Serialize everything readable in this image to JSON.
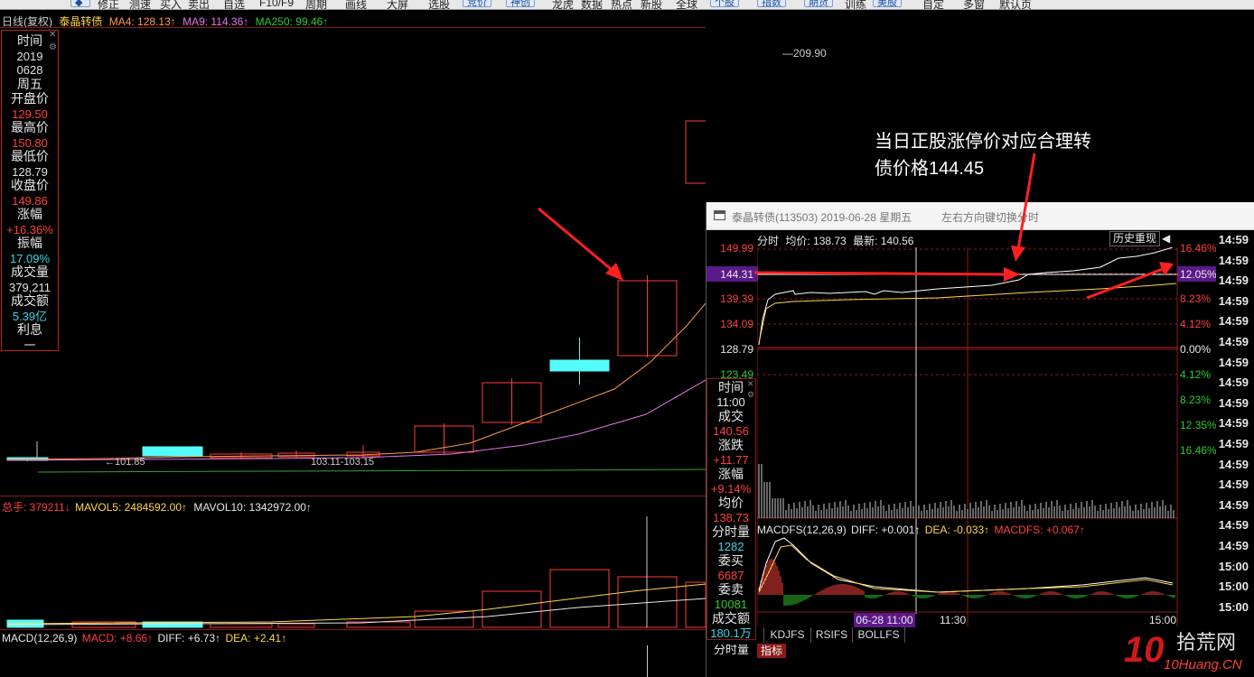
{
  "toolbar": {
    "items": [
      "修正",
      "测速",
      "买入",
      "卖出",
      "自选",
      "F10/F9",
      "周期",
      "画线",
      "大屏",
      "选股",
      "龙虎",
      "数据",
      "热点",
      "新股",
      "全球",
      "训练",
      "自定",
      "多窗",
      "默认页"
    ],
    "buttons": [
      "竞价",
      "神创",
      "个股",
      "指数",
      "期货",
      "美股"
    ]
  },
  "kline": {
    "period_label": "日线(复权)",
    "name": "泰晶转债",
    "ma4": "MA4: 128.13↑",
    "ma9": "MA9: 114.36↑",
    "ma250": "MA250: 99.46↑",
    "high_label": "209.90",
    "low_label": "←101.85",
    "range_label": "103.11-103.15",
    "colors": {
      "up": "#ff3c3c",
      "down": "#54fcfc",
      "ma4": "#ff9a4a",
      "ma9": "#e876e8",
      "ma250": "#2ea82e"
    }
  },
  "cursor_info": {
    "time_label": "时间",
    "year": "2019",
    "date": "0628",
    "weekday": "周五",
    "open_label": "开盘价",
    "open": "129.50",
    "high_label": "最高价",
    "high": "150.80",
    "low_label": "最低价",
    "low": "128.79",
    "close_label": "收盘价",
    "close": "149.86",
    "chg_label": "涨幅",
    "chg": "+16.36%",
    "amp_label": "振幅",
    "amp": "17.09%",
    "vol_label": "成交量",
    "vol": "379,211",
    "amt_label": "成交额",
    "amt": "5.39亿",
    "int_label": "利息",
    "int": "一"
  },
  "volume": {
    "total": "总手: 379211↓",
    "mavol5": "MAVOL5: 2484592.00↑",
    "mavol10": "MAVOL10: 1342972.00↑"
  },
  "macd": {
    "title": "MACD(12,26,9)",
    "macd": "MACD: +8.66↑",
    "diff": "DIFF: +6.73↑",
    "dea": "DEA: +2.41↑"
  },
  "annotation": {
    "line1": "当日正股涨停价对应合理转",
    "line2": "债价格144.45"
  },
  "popup": {
    "title": "泰晶转债(113503) 2019-06-28 星期五",
    "hint": "左右方向键切换分时",
    "header_label": "分时",
    "avg": "均价: 138.73",
    "latest": "最新: 140.56",
    "history_btn": "历史重现",
    "y_left": [
      "149.99",
      "144.31",
      "139.39",
      "134.09",
      "128.79",
      "123.49"
    ],
    "y_right": [
      "16.46%",
      "12.05%",
      "8.23%",
      "4.12%",
      "0.00%",
      "4.12%",
      "8.23%",
      "12.35%",
      "16.46%"
    ],
    "info": {
      "time_label": "时间",
      "time": "11:00",
      "deal_label": "成交",
      "deal": "140.56",
      "up_label": "涨跌",
      "up": "+11.77",
      "chg_label": "涨幅",
      "chg": "+9.14%",
      "avg_label": "均价",
      "avg": "138.73",
      "vol_label": "分时量",
      "vol": "1282",
      "buy_label": "委买",
      "buy": "6687",
      "sell_label": "委卖",
      "sell": "10081",
      "amt_label": "成交额",
      "amt": "180.1万",
      "cut_label": "分时量"
    },
    "macdfs": "MACDFS(12,26,9)",
    "macdfs_diff": "DIFF: +0.001↑",
    "macdfs_dea": "DEA: -0.033↑",
    "macdfs_val": "MACDFS: +0.067↑",
    "x_labels": [
      "06-28 11:00",
      "11:30",
      "15:00"
    ],
    "tabs": [
      "KDJFS",
      "RSIFS",
      "BOLLFS"
    ],
    "bottom_tab": "指标"
  },
  "time_list": [
    "14:59",
    "14:59",
    "14:59",
    "14:59",
    "14:59",
    "14:59",
    "14:59",
    "14:59",
    "14:59",
    "14:59",
    "14:59",
    "14:59",
    "14:59",
    "14:59",
    "14:59",
    "14:59",
    "15:00",
    "15:00",
    "15:00"
  ],
  "watermark": {
    "big": "拾荒网",
    "small": "10Huang.CN",
    "num": "10"
  }
}
